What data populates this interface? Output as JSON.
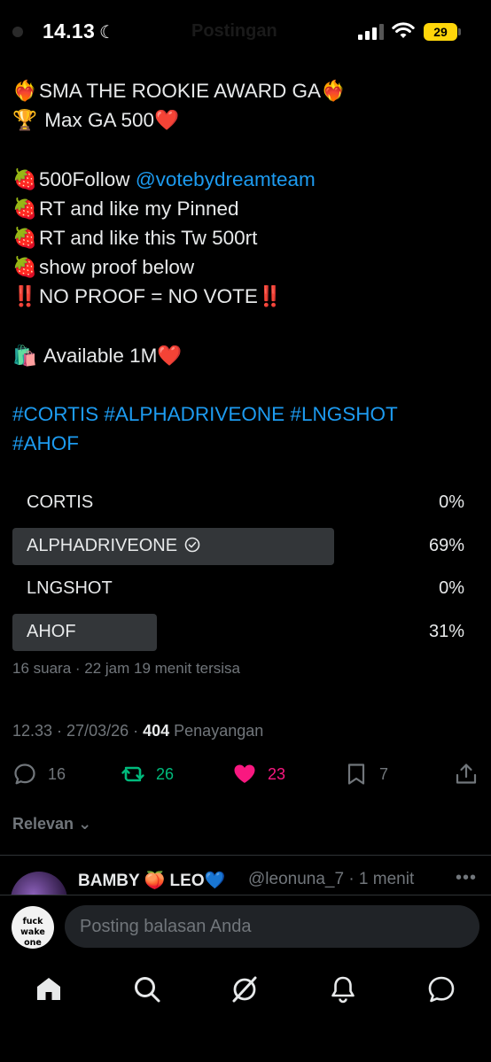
{
  "status_bar": {
    "time": "14.13",
    "header_title": "Postingan",
    "battery": "29"
  },
  "tweet": {
    "lines": [
      {
        "emoji": "❤‍🔥",
        "text": "SMA THE ROOKIE AWARD GA",
        "emoji_after": "❤‍🔥"
      },
      {
        "emoji": "🏆",
        "text": " Max GA 500",
        "emoji_after": "❤️"
      },
      {
        "emoji": "🍓",
        "text": "500Follow ",
        "link": "@votebydreamteam"
      },
      {
        "emoji": "🍓",
        "text": "RT and like my Pinned"
      },
      {
        "emoji": "🍓",
        "text": "RT and like this Tw 500rt"
      },
      {
        "emoji": "🍓",
        "text": "show proof below"
      },
      {
        "emoji": "‼️",
        "text": "NO PROOF = NO VOTE",
        "emoji_after": "‼️"
      },
      {
        "emoji": "🛍️",
        "text": " Available 1M",
        "emoji_after": "❤️"
      }
    ],
    "hashtags_line1": "#CORTIS #ALPHADRIVEONE #LNGSHOT",
    "hashtags_line2": "#AHOF"
  },
  "poll": {
    "options": [
      {
        "label": "CORTIS",
        "percent": "0%",
        "fraction": 0.0,
        "selected": false
      },
      {
        "label": "ALPHADRIVEONE",
        "percent": "69%",
        "fraction": 0.69,
        "selected": true
      },
      {
        "label": "LNGSHOT",
        "percent": "0%",
        "fraction": 0.0,
        "selected": false
      },
      {
        "label": "AHOF",
        "percent": "31%",
        "fraction": 0.31,
        "selected": false
      }
    ],
    "meta": "16 suara · 22 jam 19 menit tersisa"
  },
  "timestamp": {
    "datetime": "12.33 · 27/03/26 · ",
    "views_count": "404",
    "views_label": " Penayangan"
  },
  "actions": {
    "replies": "16",
    "reposts": "26",
    "likes": "23",
    "bookmarks": "7"
  },
  "sort_label": "Relevan",
  "reply_preview": {
    "name": "BAMBY 🍑 LEO💙",
    "handle": "@leonuna_7 · 1 menit"
  },
  "compose": {
    "avatar_text": "fuck wake one",
    "placeholder": "Posting balasan Anda"
  },
  "colors": {
    "accent": "#1d9bf0",
    "repost": "#00ba7c",
    "like": "#f91880",
    "muted": "#71767b",
    "poll_bar": "#333639"
  }
}
